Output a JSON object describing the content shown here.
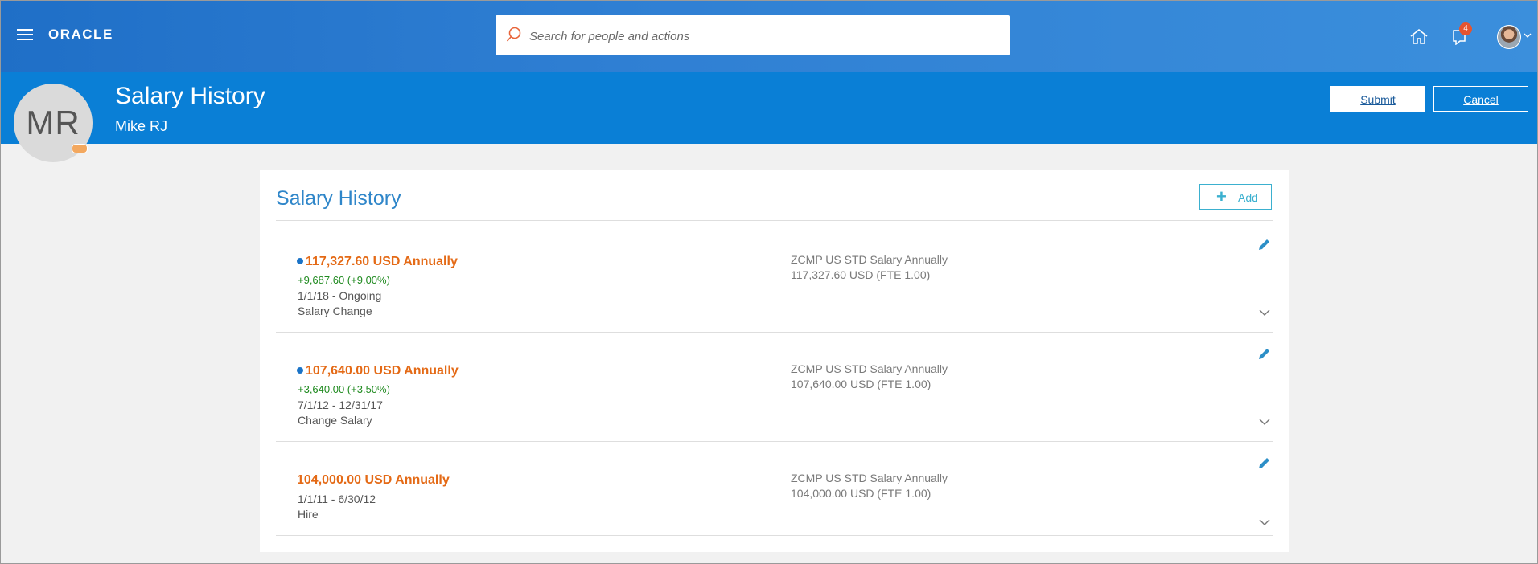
{
  "topbar": {
    "logo": "ORACLE",
    "search_placeholder": "Search for people and actions",
    "notification_count": "4",
    "icons": {
      "menu": "hamburger-icon",
      "search": "search-icon",
      "home": "home-icon",
      "notifications": "notification-icon",
      "user": "user-avatar",
      "user_menu": "chevron-down-icon"
    }
  },
  "header": {
    "initials": "MR",
    "title": "Salary History",
    "subtitle": "Mike RJ",
    "submit_label": "Submit",
    "cancel_label": "Cancel"
  },
  "card": {
    "title": "Salary History",
    "add_label": "Add",
    "entries": [
      {
        "current": true,
        "amount": "117,327.60 USD Annually",
        "change": "+9,687.60  (+9.00%)",
        "dates": "1/1/18 - Ongoing",
        "reason": "Salary Change",
        "plan": "ZCMP US STD Salary Annually",
        "plan_amount": "117,327.60 USD (FTE 1.00)"
      },
      {
        "current": true,
        "amount": "107,640.00 USD Annually",
        "change": "+3,640.00  (+3.50%)",
        "dates": "7/1/12 - 12/31/17",
        "reason": "Change Salary",
        "plan": "ZCMP US STD Salary Annually",
        "plan_amount": "107,640.00 USD (FTE 1.00)"
      },
      {
        "current": false,
        "amount": "104,000.00 USD Annually",
        "change": "",
        "dates": "1/1/11 - 6/30/12",
        "reason": "Hire",
        "plan": "ZCMP US STD Salary Annually",
        "plan_amount": "104,000.00 USD (FTE 1.00)"
      }
    ]
  },
  "colors": {
    "topbar": "#2f7fd3",
    "header": "#0a7fd6",
    "amount": "#e46a16",
    "change": "#1f8a1f",
    "title": "#2f86c9",
    "accent": "#3bb0cf"
  }
}
